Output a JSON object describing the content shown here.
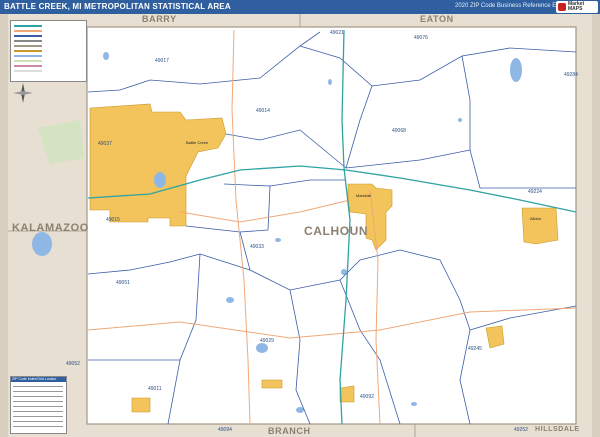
{
  "title": "BATTLE CREEK, MI METROPOLITAN STATISTICAL AREA",
  "edition": "2020 ZIP Code Business Reference Edition",
  "logo": {
    "line1": "Market",
    "line2": "MAPS",
    "line3": "Marketplace"
  },
  "colors": {
    "title_bar": "#2f5f9e",
    "outside_county": "#e7dfd2",
    "county_fill": "#ffffff",
    "urban_area": "#f2c45b",
    "zip_boundary": "#3b5da8",
    "interstate": "#2fa3a3",
    "highway": "#f0a878",
    "water": "#8fb7e6"
  },
  "counties": {
    "north_west": "BARRY",
    "north_east": "EATON",
    "west": "KALAMAZOO",
    "center": "CALHOUN",
    "south": "BRANCH",
    "south_east": "HILLSDALE"
  },
  "zip_labels": [
    "49021",
    "49076",
    "49284",
    "49017",
    "49014",
    "49068",
    "49037",
    "49015",
    "49224",
    "49033",
    "49051",
    "49029",
    "49245",
    "49052",
    "49011",
    "49092",
    "49094",
    "49252"
  ],
  "cities": [
    "Battle Creek",
    "Marshall",
    "Albion"
  ],
  "legend": {
    "zip_header": "ZIP Code Index/Grid Locator"
  }
}
